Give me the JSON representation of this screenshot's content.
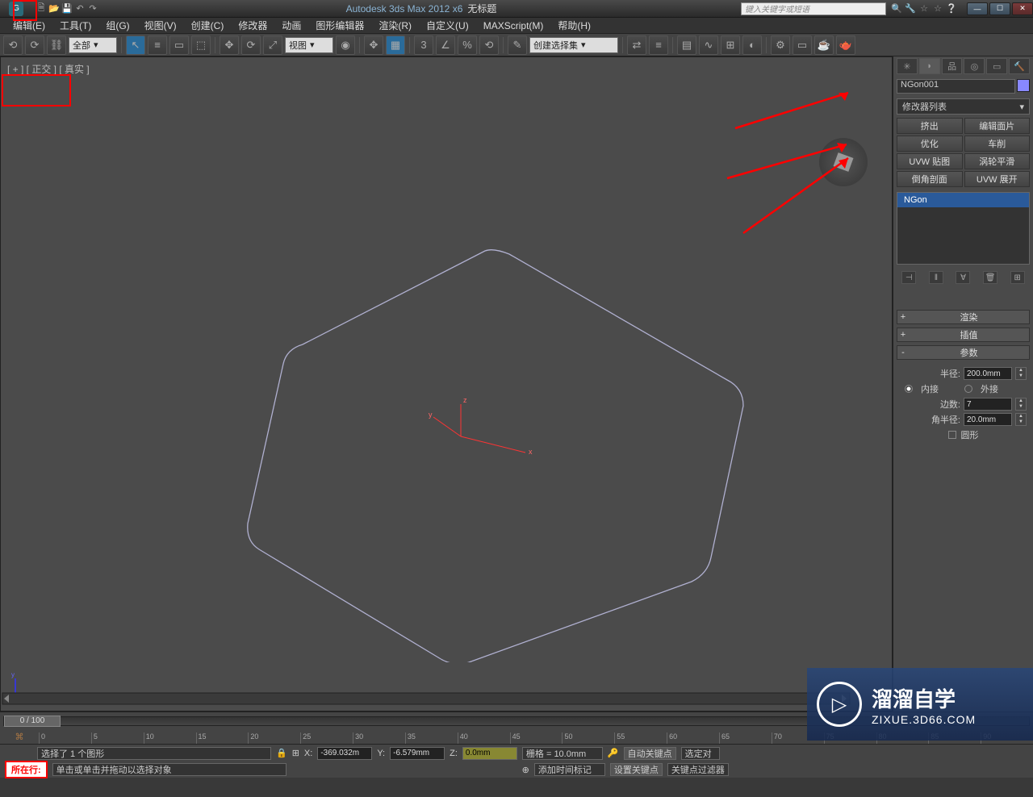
{
  "title": {
    "app": "Autodesk 3ds Max  2012 x6",
    "file": "无标题"
  },
  "search_placeholder": "键入关键字或短语",
  "menu": [
    "编辑(E)",
    "工具(T)",
    "组(G)",
    "视图(V)",
    "创建(C)",
    "修改器",
    "动画",
    "图形编辑器",
    "渲染(R)",
    "自定义(U)",
    "MAXScript(M)",
    "帮助(H)"
  ],
  "toolbar": {
    "all": "全部",
    "view": "视图",
    "create_set": "创建选择集"
  },
  "viewport_label": "[ + ] [ 正交 ] [ 真实 ]",
  "cmd_panel": {
    "object_name": "NGon001",
    "mod_list_label": "修改器列表",
    "mod_buttons": [
      "挤出",
      "编辑面片",
      "优化",
      "车削",
      "UVW 贴图",
      "涡轮平滑",
      "倒角剖面",
      "UVW 展开"
    ],
    "stack_item": "NGon",
    "rollouts": [
      "渲染",
      "插值",
      "参数"
    ],
    "params": {
      "radius_label": "半径:",
      "radius": "200.0mm",
      "inscribed": "内接",
      "circumscribed": "外接",
      "sides_label": "边数:",
      "sides": "7",
      "corner_radius_label": "角半径:",
      "corner_radius": "20.0mm",
      "circular": "圆形"
    }
  },
  "time": {
    "slider": "0 / 100",
    "ticks": [
      "0",
      "5",
      "10",
      "15",
      "20",
      "25",
      "30",
      "35",
      "40",
      "45",
      "50",
      "55",
      "60",
      "65",
      "70",
      "75",
      "80",
      "85",
      "90"
    ]
  },
  "status": {
    "selection": "选择了 1 个图形",
    "x": "-369.032m",
    "y": "-6.579mm",
    "z": "0.0mm",
    "grid": "栅格 = 10.0mm",
    "autokey": "自动关键点",
    "selected": "选定对",
    "onrow": "所在行:",
    "hint": "单击或单击并拖动以选择对象",
    "addmarker": "添加时间标记",
    "setkey": "设置关键点",
    "keyfilter": "关键点过滤器"
  },
  "watermark": {
    "cn": "溜溜自学",
    "en": "ZIXUE.3D66.COM"
  }
}
